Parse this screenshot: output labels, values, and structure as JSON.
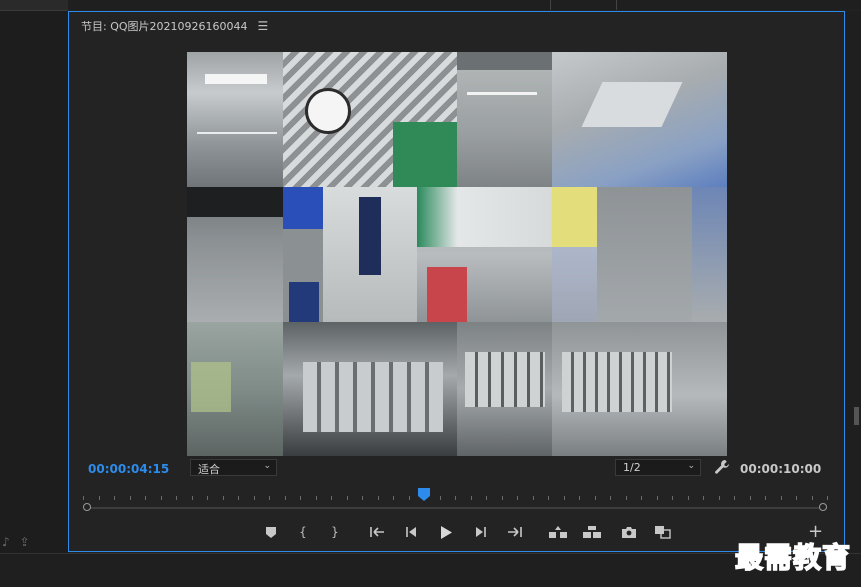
{
  "monitor": {
    "title": "节目: QQ图片20210926160044",
    "menu_icon": "hamburger-menu-icon",
    "current_time": "00:00:04:15",
    "fit_value": "适合",
    "resolution_value": "1/2",
    "duration": "00:00:10:00",
    "accent_color": "#2d8ceb"
  },
  "transport": {
    "buttons": [
      {
        "name": "add-marker-button",
        "icon": "marker-icon",
        "glyph": "⬟"
      },
      {
        "name": "mark-in-button",
        "icon": "mark-in-icon",
        "glyph": "{"
      },
      {
        "name": "mark-out-button",
        "icon": "mark-out-icon",
        "glyph": "}"
      },
      {
        "name": "go-to-in-button",
        "icon": "go-to-in-icon",
        "glyph": "{⇤"
      },
      {
        "name": "step-back-button",
        "icon": "step-back-icon",
        "glyph": "◀|"
      },
      {
        "name": "play-button",
        "icon": "play-icon",
        "glyph": "▶"
      },
      {
        "name": "step-forward-button",
        "icon": "step-forward-icon",
        "glyph": "|▶"
      },
      {
        "name": "go-to-out-button",
        "icon": "go-to-out-icon",
        "glyph": "⇥}"
      },
      {
        "name": "lift-button",
        "icon": "lift-icon",
        "glyph": "⏏"
      },
      {
        "name": "extract-button",
        "icon": "extract-icon",
        "glyph": "⏏"
      },
      {
        "name": "export-frame-button",
        "icon": "camera-icon",
        "glyph": "📷"
      },
      {
        "name": "compare-view-button",
        "icon": "compare-view-icon",
        "glyph": "⧉"
      }
    ],
    "add_button_icon": "plus-icon"
  },
  "watermark": "最需教育"
}
